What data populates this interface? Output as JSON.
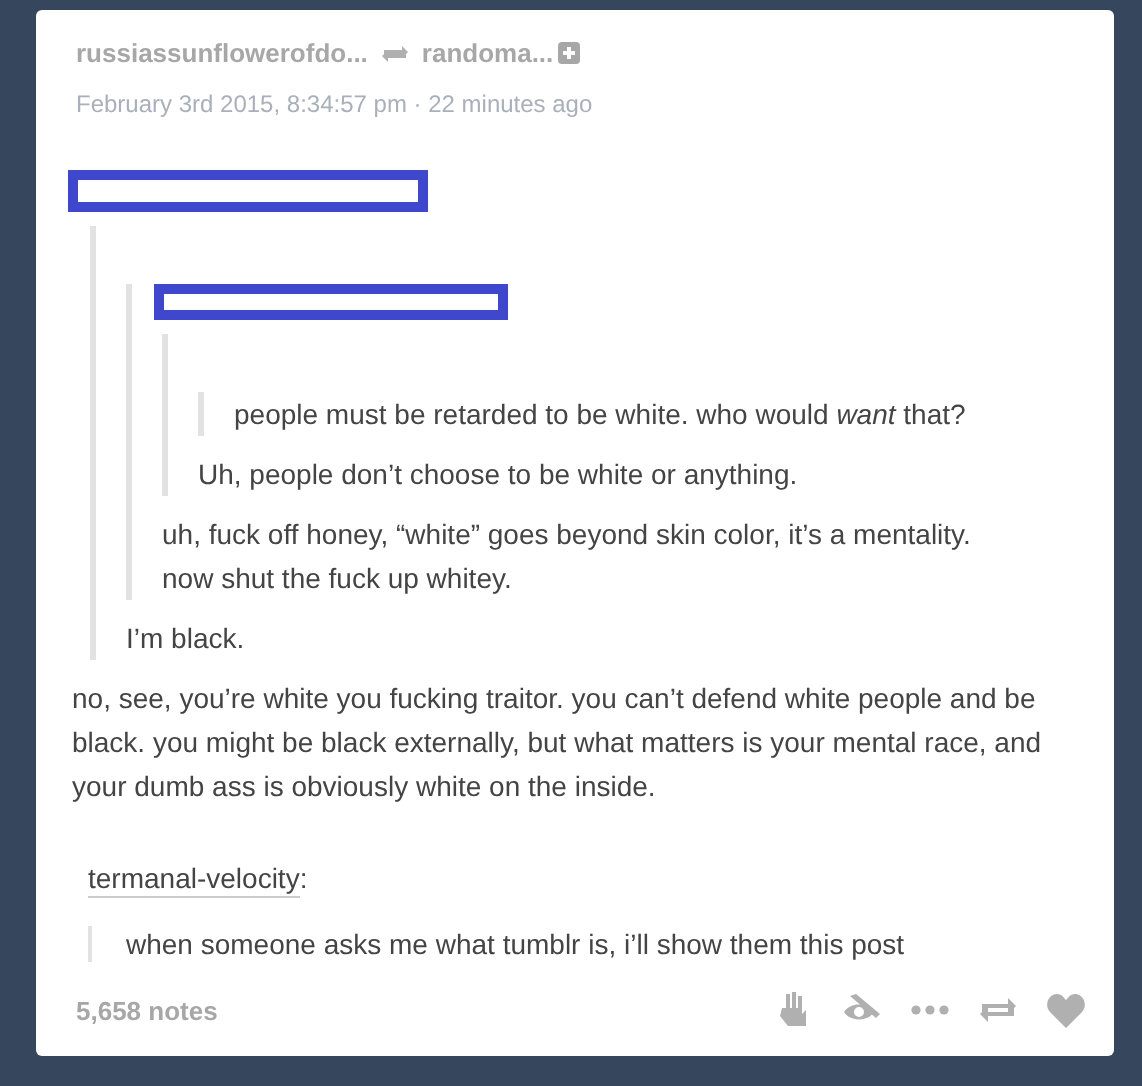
{
  "header": {
    "blog": "russiassunflowerofdo...",
    "reblogged_from": "randoma...",
    "timestamp": "February 3rd 2015, 8:34:57 pm · 22 minutes ago"
  },
  "thread": {
    "redacted": true,
    "quote": {
      "quote": {
        "redacted": true,
        "quote": {
          "quote": {
            "paragraphs": [
              "people must be retarded to be white. who would *want* that?"
            ]
          },
          "paragraphs": [
            "Uh, people don’t choose to be white or anything."
          ]
        },
        "paragraphs": [
          "uh, fuck off honey, “white” goes beyond skin color, it’s a mentality. now shut the fuck up whitey."
        ]
      },
      "paragraphs": [
        "I’m black."
      ]
    },
    "paragraphs": [
      "no, see, you’re white you fucking traitor. you can’t defend white people and be black. you might be black externally, but what matters is your mental race, and your dumb ass is obviously white on the inside."
    ]
  },
  "reblog": {
    "author": "termanal-velocity",
    "suffix": ":",
    "comment": "when someone asks me what tumblr is, i’ll show them this post"
  },
  "footer": {
    "notes": "5,658 notes"
  }
}
